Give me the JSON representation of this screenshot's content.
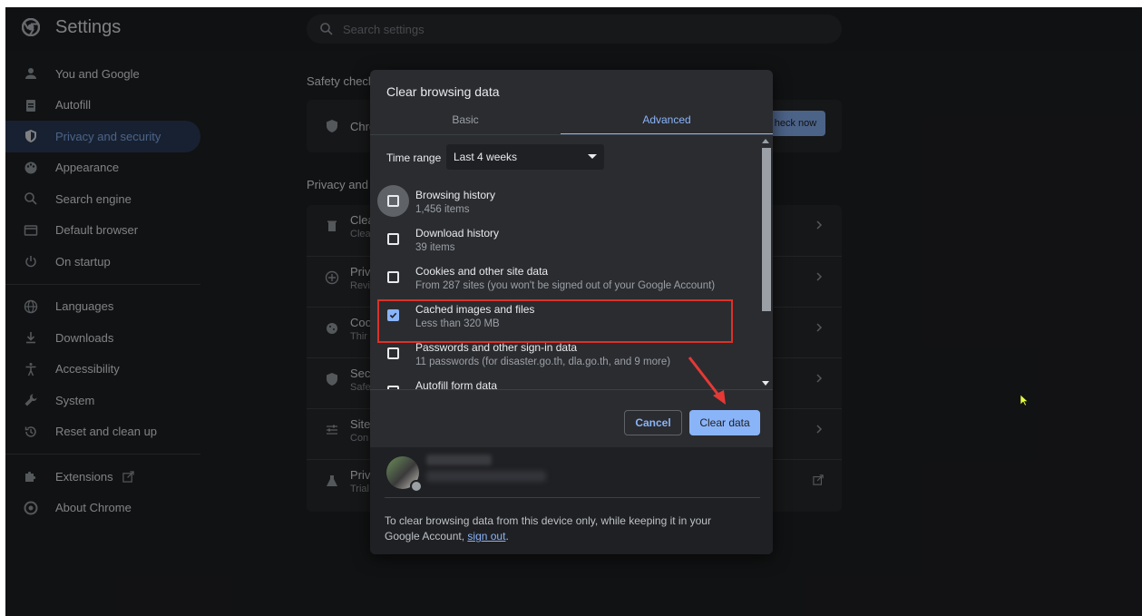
{
  "app": {
    "title": "Settings"
  },
  "search": {
    "placeholder": "Search settings"
  },
  "sidebar": {
    "items": [
      {
        "label": "You and Google",
        "icon": "person-icon"
      },
      {
        "label": "Autofill",
        "icon": "clipboard-icon"
      },
      {
        "label": "Privacy and security",
        "icon": "shield-icon",
        "active": true
      },
      {
        "label": "Appearance",
        "icon": "palette-icon"
      },
      {
        "label": "Search engine",
        "icon": "search-icon"
      },
      {
        "label": "Default browser",
        "icon": "browser-icon"
      },
      {
        "label": "On startup",
        "icon": "power-icon"
      },
      {
        "label": "Languages",
        "icon": "globe-icon"
      },
      {
        "label": "Downloads",
        "icon": "download-icon"
      },
      {
        "label": "Accessibility",
        "icon": "accessibility-icon"
      },
      {
        "label": "System",
        "icon": "wrench-icon"
      },
      {
        "label": "Reset and clean up",
        "icon": "history-icon"
      },
      {
        "label": "Extensions",
        "icon": "puzzle-icon"
      },
      {
        "label": "About Chrome",
        "icon": "chrome-icon"
      }
    ]
  },
  "background": {
    "safety_check_title": "Safety check",
    "safety_row_text": "Chro",
    "check_now_label": "heck now",
    "privacy_title": "Privacy and",
    "rows": [
      {
        "t1": "Clea",
        "t2": "Clea"
      },
      {
        "t1": "Priv",
        "t2": "Revi"
      },
      {
        "t1": "Coo",
        "t2": "Thir"
      },
      {
        "t1": "Secu",
        "t2": "Safe"
      },
      {
        "t1": "Site",
        "t2": "Con"
      },
      {
        "t1": "Priv",
        "t2": "Trial"
      }
    ]
  },
  "dialog": {
    "title": "Clear browsing data",
    "tabs": {
      "basic": "Basic",
      "advanced": "Advanced"
    },
    "time_range_label": "Time range",
    "time_range_value": "Last 4 weeks",
    "items": [
      {
        "title": "Browsing history",
        "subtitle": "1,456 items",
        "checked": false
      },
      {
        "title": "Download history",
        "subtitle": "39 items",
        "checked": false
      },
      {
        "title": "Cookies and other site data",
        "subtitle": "From 287 sites (you won't be signed out of your Google Account)",
        "checked": false
      },
      {
        "title": "Cached images and files",
        "subtitle": "Less than 320 MB",
        "checked": true
      },
      {
        "title": "Passwords and other sign-in data",
        "subtitle": "11 passwords (for disaster.go.th, dla.go.th, and 9 more)",
        "checked": false
      },
      {
        "title": "Autofill form data",
        "subtitle": "",
        "checked": false
      }
    ],
    "cancel_label": "Cancel",
    "clear_label": "Clear data",
    "footer_text": "To clear browsing data from this device only, while keeping it in your Google Account,",
    "sign_out_label": "sign out",
    "footer_end": "."
  },
  "colors": {
    "accent": "#8ab4f8",
    "highlight": "#d9322a",
    "annotation_arrow": "#e53935"
  }
}
